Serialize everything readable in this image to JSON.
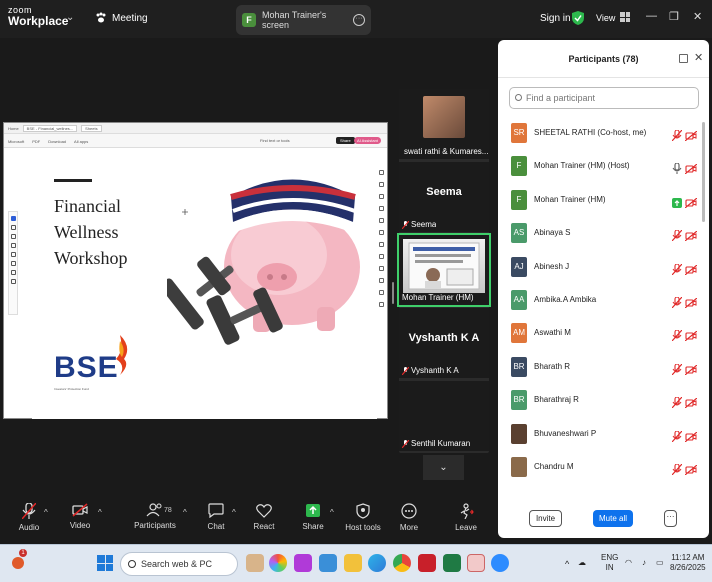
{
  "topbar": {
    "logo_line1": "zoom",
    "logo_line2": "Workplace",
    "meeting_label": "Meeting",
    "share_badge": "F",
    "share_tab_label": "Mohan Trainer's screen",
    "signin_label": "Sign in",
    "view_label": "View",
    "win_min": "—",
    "win_max": "❐",
    "win_close": "✕"
  },
  "shared_screen": {
    "browser_tab1": "Home",
    "browser_tab2": "BSE - Financial_wellnes...",
    "browser_tab3": "Sheets",
    "menus": [
      "Microsoft",
      "PDF",
      "Download",
      "All apps"
    ],
    "find_text": "Find text or tools",
    "share_btn": "Share",
    "ai_btn": "AI Assistant",
    "slide_title": "Financial\nWellness\nWorkshop",
    "brand": "BSE",
    "brand_tagline": "Investors' Protection Fund"
  },
  "video_tiles": [
    {
      "name": "swati rathi & Kumares..."
    },
    {
      "big": "Seema",
      "name": "Seema"
    },
    {
      "name": "Mohan Trainer (HM)"
    },
    {
      "big": "Vyshanth K A",
      "name": "Vyshanth K A"
    },
    {
      "name": "Senthil Kumaran"
    }
  ],
  "collapse_label": "⌄",
  "participants": {
    "title": "Participants (78)",
    "search_placeholder": "Find a participant",
    "rows": [
      {
        "initials": "SR",
        "color": "#e0763a",
        "name": "SHEETAL RATHI (Co-host, me)",
        "mic": "off",
        "cam": "off"
      },
      {
        "initials": "F",
        "color": "#4a8f3c",
        "name": "Mohan Trainer (HM) (Host)",
        "mic": "on",
        "cam": "off"
      },
      {
        "initials": "F",
        "color": "#4a8f3c",
        "name": "Mohan Trainer (HM)",
        "mic": "share",
        "cam": "off"
      },
      {
        "initials": "AS",
        "color": "#4a9a6a",
        "name": "Abinaya S",
        "mic": "off",
        "cam": "off"
      },
      {
        "initials": "AJ",
        "color": "#3a4a62",
        "name": "Abinesh J",
        "mic": "off",
        "cam": "off"
      },
      {
        "initials": "AA",
        "color": "#4a9a6a",
        "name": "Ambika.A Ambika",
        "mic": "off",
        "cam": "off"
      },
      {
        "initials": "AM",
        "color": "#e0763a",
        "name": "Aswathi M",
        "mic": "off",
        "cam": "off"
      },
      {
        "initials": "BR",
        "color": "#3a4a62",
        "name": "Bharath R",
        "mic": "off",
        "cam": "off"
      },
      {
        "initials": "BR",
        "color": "#4a9a6a",
        "name": "Bharathraj R",
        "mic": "off",
        "cam": "off"
      },
      {
        "initials": "",
        "color": "#5a4030",
        "name": "Bhuvaneshwari P",
        "mic": "off",
        "cam": "off"
      },
      {
        "initials": "",
        "color": "#8a6a4a",
        "name": "Chandru M",
        "mic": "off",
        "cam": "off"
      }
    ],
    "invite_label": "Invite",
    "mute_all_label": "Mute all",
    "more_label": "···"
  },
  "toolbar": {
    "audio": "Audio",
    "video": "Video",
    "participants": "Participants",
    "participants_count": "78",
    "chat": "Chat",
    "react": "React",
    "share": "Share",
    "host_tools": "Host tools",
    "more": "More",
    "leave": "Leave"
  },
  "taskbar": {
    "notif_count": "1",
    "search_text": "Search web & PC",
    "lang1": "ENG",
    "lang2": "IN",
    "time": "11:12 AM",
    "date": "8/26/2025"
  },
  "colors": {
    "accent": "#0e72ed",
    "mic_off_red": "#e02828",
    "active_speaker": "#3fcf6a"
  }
}
